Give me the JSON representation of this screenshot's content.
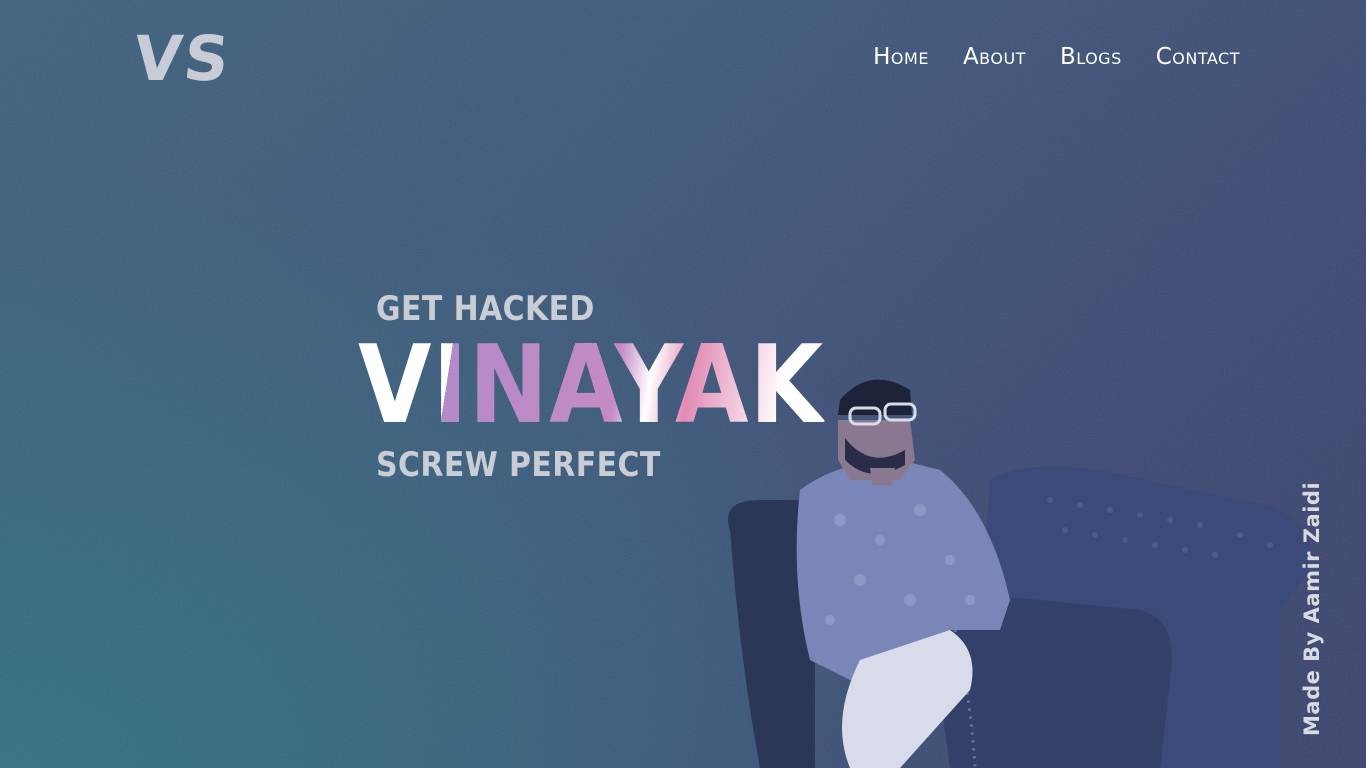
{
  "brand": {
    "logo_text": "VS"
  },
  "nav": {
    "items": [
      {
        "label": "Home"
      },
      {
        "label": "About"
      },
      {
        "label": "Blogs"
      },
      {
        "label": "Contact"
      }
    ]
  },
  "hero": {
    "tagline_top": "GET HACKED",
    "name": "VINAYAK",
    "tagline_bottom": "SCREW PERFECT"
  },
  "footer": {
    "credit": "Made By Aamir Zaidi"
  },
  "colors": {
    "background_start": "#3a5f7c",
    "background_end": "#37406a",
    "accent_purple": "#b58ac8",
    "accent_pink": "#e28bb4",
    "text_light": "#c9cdd6"
  }
}
